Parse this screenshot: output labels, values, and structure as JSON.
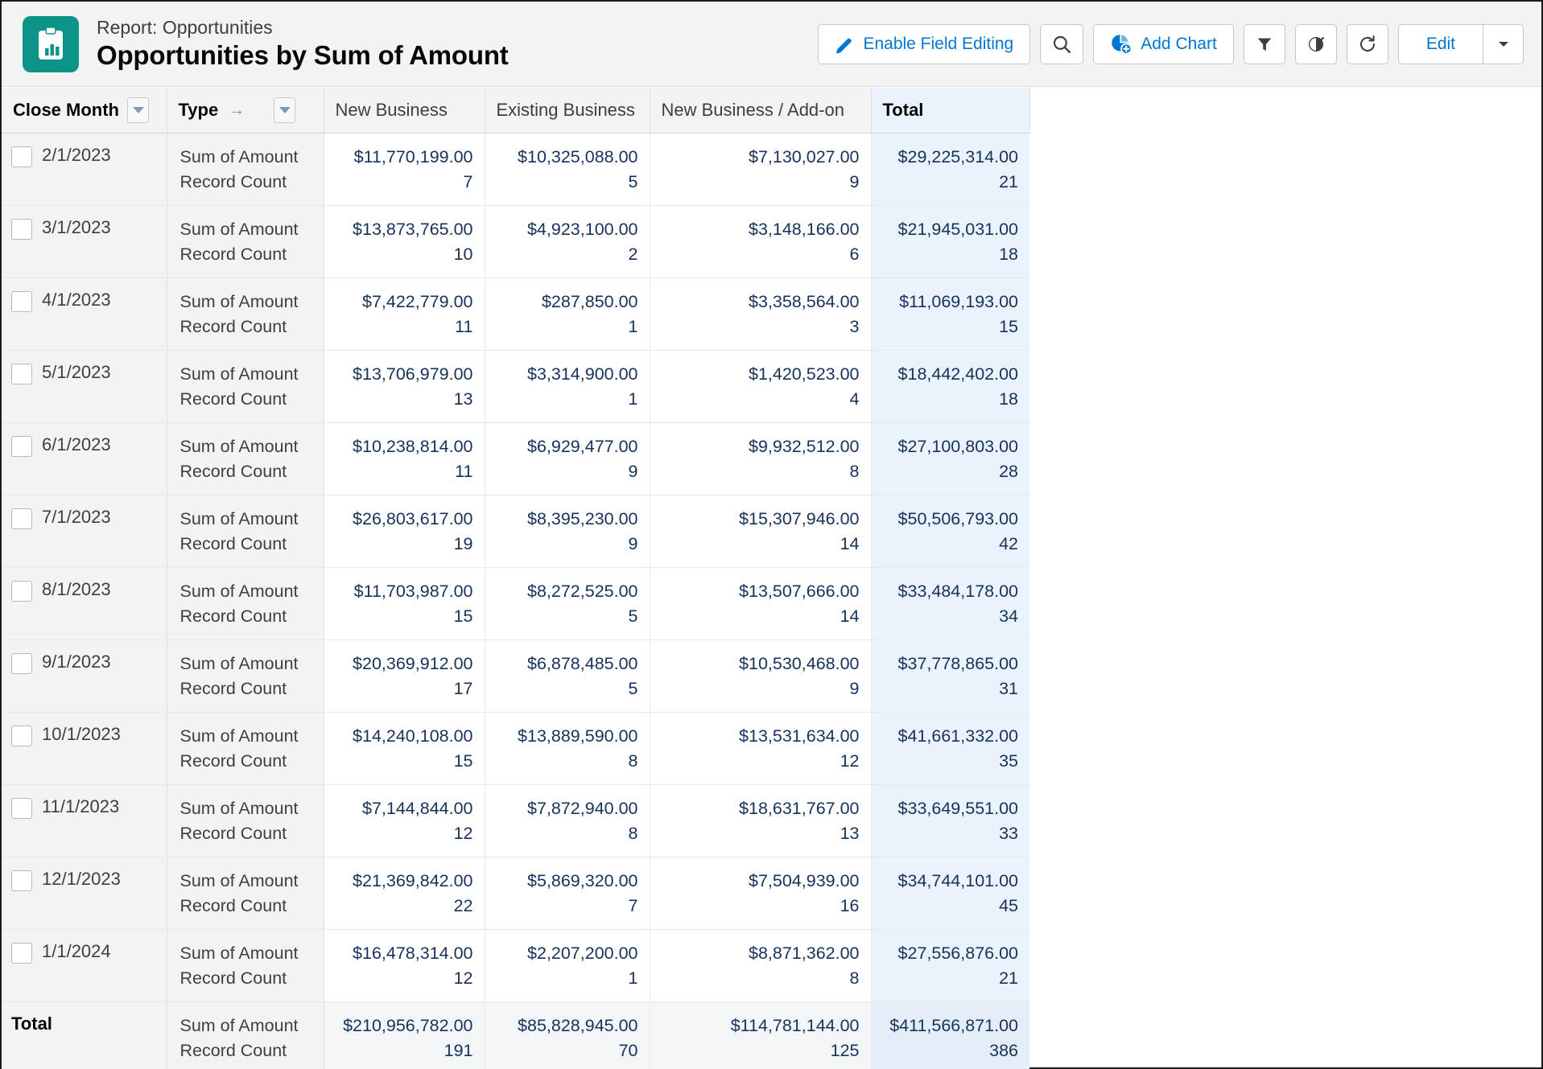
{
  "header": {
    "kicker": "Report: Opportunities",
    "title": "Opportunities by Sum of Amount",
    "icon": "report-clipboard-icon",
    "accent_color": "#0d9488"
  },
  "toolbar": {
    "enable_field_editing": "Enable Field Editing",
    "search_icon": "search-icon",
    "add_chart": "Add Chart",
    "filter_icon": "filter-icon",
    "conditional_formatting_icon": "conditional-formatting-icon",
    "refresh_icon": "refresh-icon",
    "edit": "Edit",
    "edit_menu_icon": "chevron-down-icon",
    "link_color": "#0176d3"
  },
  "table": {
    "group_headers": [
      {
        "label": "Close Month",
        "has_caret": true,
        "has_arrow": false
      },
      {
        "label": "Type",
        "has_caret": true,
        "has_arrow": true
      }
    ],
    "column_headers": [
      "New Business",
      "Existing Business",
      "New Business / Add-on"
    ],
    "total_header": "Total",
    "measures": [
      "Sum of Amount",
      "Record Count"
    ],
    "rows": [
      {
        "month": "2/1/2023",
        "sum": [
          "$11,770,199.00",
          "$10,325,088.00",
          "$7,130,027.00",
          "$29,225,314.00"
        ],
        "count": [
          "7",
          "5",
          "9",
          "21"
        ]
      },
      {
        "month": "3/1/2023",
        "sum": [
          "$13,873,765.00",
          "$4,923,100.00",
          "$3,148,166.00",
          "$21,945,031.00"
        ],
        "count": [
          "10",
          "2",
          "6",
          "18"
        ]
      },
      {
        "month": "4/1/2023",
        "sum": [
          "$7,422,779.00",
          "$287,850.00",
          "$3,358,564.00",
          "$11,069,193.00"
        ],
        "count": [
          "11",
          "1",
          "3",
          "15"
        ]
      },
      {
        "month": "5/1/2023",
        "sum": [
          "$13,706,979.00",
          "$3,314,900.00",
          "$1,420,523.00",
          "$18,442,402.00"
        ],
        "count": [
          "13",
          "1",
          "4",
          "18"
        ]
      },
      {
        "month": "6/1/2023",
        "sum": [
          "$10,238,814.00",
          "$6,929,477.00",
          "$9,932,512.00",
          "$27,100,803.00"
        ],
        "count": [
          "11",
          "9",
          "8",
          "28"
        ]
      },
      {
        "month": "7/1/2023",
        "sum": [
          "$26,803,617.00",
          "$8,395,230.00",
          "$15,307,946.00",
          "$50,506,793.00"
        ],
        "count": [
          "19",
          "9",
          "14",
          "42"
        ]
      },
      {
        "month": "8/1/2023",
        "sum": [
          "$11,703,987.00",
          "$8,272,525.00",
          "$13,507,666.00",
          "$33,484,178.00"
        ],
        "count": [
          "15",
          "5",
          "14",
          "34"
        ]
      },
      {
        "month": "9/1/2023",
        "sum": [
          "$20,369,912.00",
          "$6,878,485.00",
          "$10,530,468.00",
          "$37,778,865.00"
        ],
        "count": [
          "17",
          "5",
          "9",
          "31"
        ]
      },
      {
        "month": "10/1/2023",
        "sum": [
          "$14,240,108.00",
          "$13,889,590.00",
          "$13,531,634.00",
          "$41,661,332.00"
        ],
        "count": [
          "15",
          "8",
          "12",
          "35"
        ]
      },
      {
        "month": "11/1/2023",
        "sum": [
          "$7,144,844.00",
          "$7,872,940.00",
          "$18,631,767.00",
          "$33,649,551.00"
        ],
        "count": [
          "12",
          "8",
          "13",
          "33"
        ]
      },
      {
        "month": "12/1/2023",
        "sum": [
          "$21,369,842.00",
          "$5,869,320.00",
          "$7,504,939.00",
          "$34,744,101.00"
        ],
        "count": [
          "22",
          "7",
          "16",
          "45"
        ]
      },
      {
        "month": "1/1/2024",
        "sum": [
          "$16,478,314.00",
          "$2,207,200.00",
          "$8,871,362.00",
          "$27,556,876.00"
        ],
        "count": [
          "12",
          "1",
          "8",
          "21"
        ]
      }
    ],
    "grand_total": {
      "label": "Total",
      "sum": [
        "$210,956,782.00",
        "$85,828,945.00",
        "$114,781,144.00",
        "$411,566,871.00"
      ],
      "count": [
        "191",
        "70",
        "125",
        "386"
      ]
    }
  }
}
